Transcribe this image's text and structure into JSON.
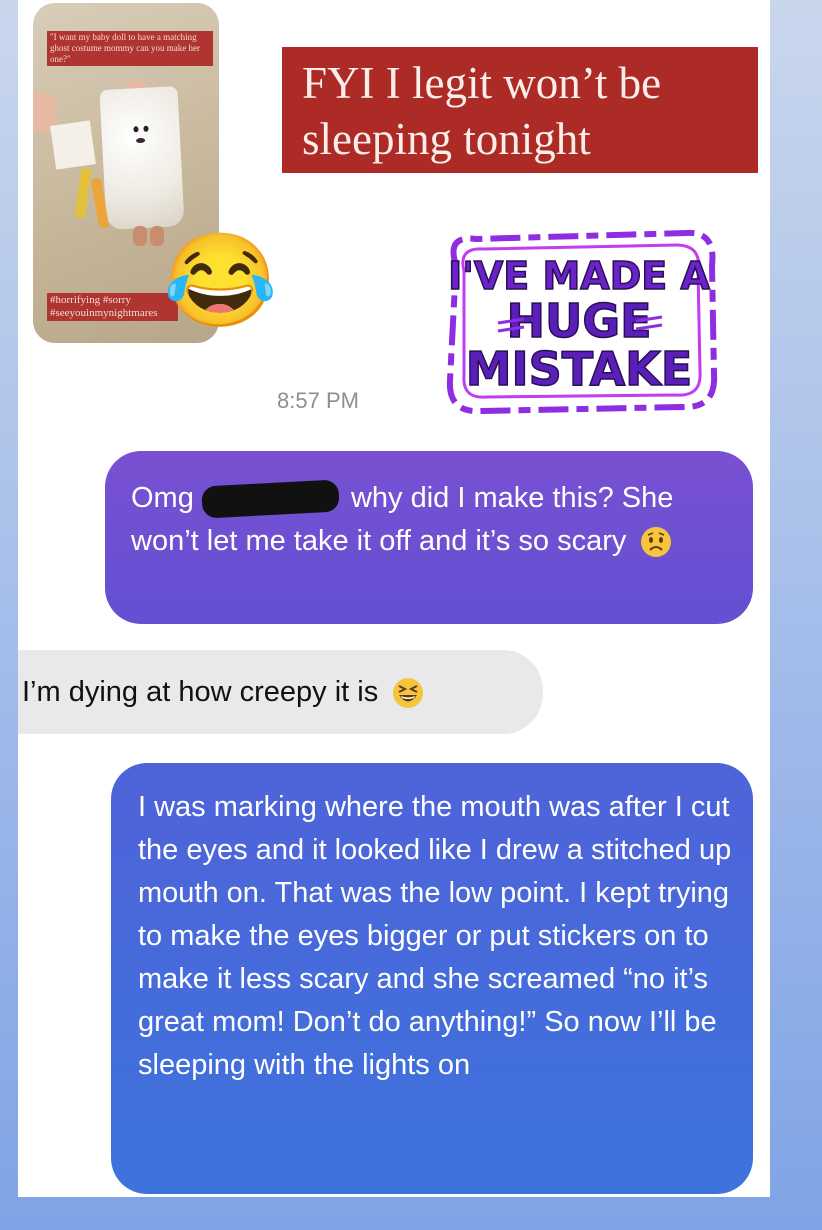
{
  "story": {
    "caption": "\"I want my baby doll to have a matching ghost costume mommy can you make her one?\"",
    "tags": "#horrifying #sorry #seeyouinmynightmares"
  },
  "banner": {
    "text": "FYI I legit won’t be sleeping tonight"
  },
  "sticker": {
    "line1": "I'VE MADE A",
    "line2": "HUGE",
    "line3": "MISTAKE"
  },
  "timestamp": "8:57 PM",
  "messages": {
    "m1": {
      "before": "Omg",
      "after": "why did I make this? She won’t let me take it off and it’s so scary"
    },
    "m2": {
      "text": "I’m dying at how creepy it is"
    },
    "m3": {
      "text": "I was marking where the mouth was after I cut the eyes and it looked like I drew a stitched up mouth on. That was the low point. I kept trying to make the eyes bigger or put stickers on to make it less scary and she screamed “no it’s great mom! Don’t do anything!” So now I’ll be sleeping with the lights on"
    }
  },
  "icons": {
    "laugh_emoji": "😂",
    "worried_emoji": "worried-face-icon",
    "grin_emoji": "grinning-squinting-face-icon"
  },
  "colors": {
    "banner_bg": "#ac2b26",
    "sent_bubble_top": "#7a50d2",
    "sent_bubble_bottom": "#3d73dd",
    "received_bubble": "#e9e9eb",
    "sticker_purple": "#8f2de0"
  }
}
